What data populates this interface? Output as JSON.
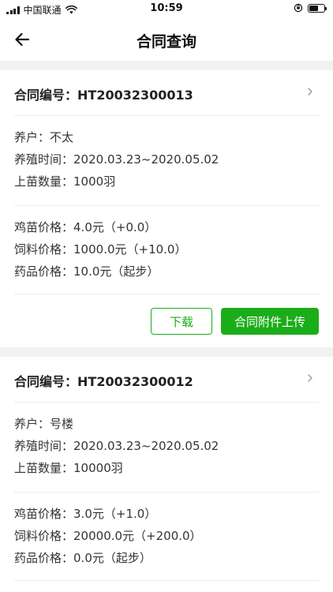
{
  "status_bar": {
    "carrier": "中国联通",
    "time": "10:59",
    "battery_level": 0.6
  },
  "header": {
    "title": "合同查询"
  },
  "contracts": [
    {
      "label_no": "合同编号：",
      "contract_no": "HT20032300013",
      "farmer_label": "养户：",
      "farmer": "不太",
      "period_label": "养殖时间：",
      "period": "2020.03.23~2020.05.02",
      "qty_label": "上苗数量：",
      "qty": "1000羽",
      "chick_label": "鸡苗价格：",
      "chick_price": "4.0元（+0.0）",
      "feed_label": "饲料价格：",
      "feed_price": "1000.0元（+10.0）",
      "drug_label": "药品价格：",
      "drug_price": "10.0元（起步）",
      "download_label": "下载",
      "upload_label": "合同附件上传"
    },
    {
      "label_no": "合同编号：",
      "contract_no": "HT20032300012",
      "farmer_label": "养户：",
      "farmer": "号楼",
      "period_label": "养殖时间：",
      "period": "2020.03.23~2020.05.02",
      "qty_label": "上苗数量：",
      "qty": "10000羽",
      "chick_label": "鸡苗价格：",
      "chick_price": "3.0元（+1.0）",
      "feed_label": "饲料价格：",
      "feed_price": "20000.0元（+200.0）",
      "drug_label": "药品价格：",
      "drug_price": "0.0元（起步）"
    }
  ]
}
